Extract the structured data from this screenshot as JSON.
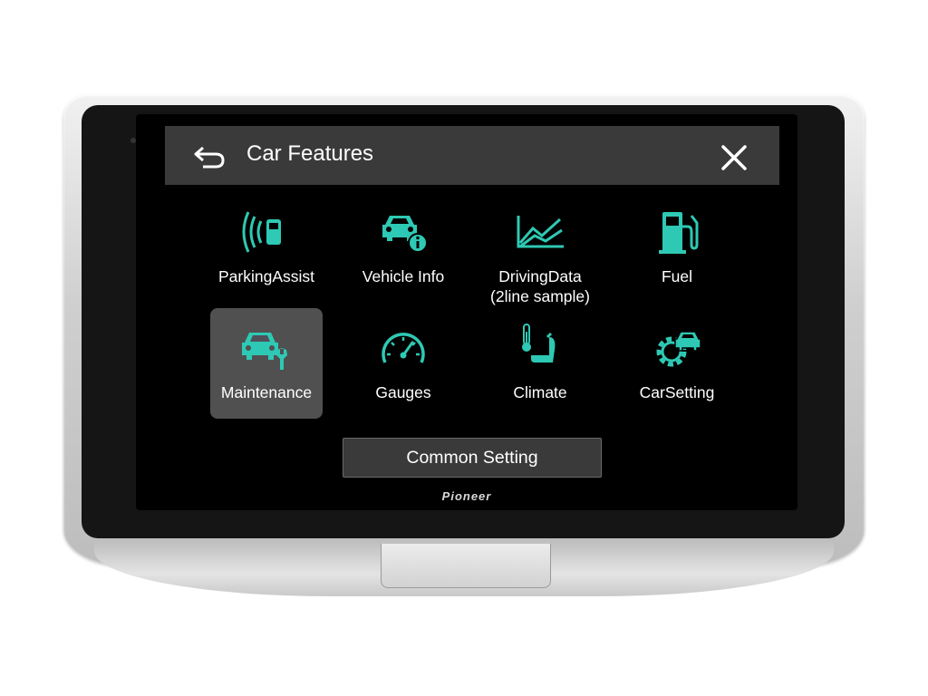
{
  "header": {
    "title": "Car Features",
    "back_icon": "back-arrow-icon",
    "close_icon": "close-icon"
  },
  "features": [
    {
      "label": "ParkingAssist",
      "icon": "parking-assist-icon",
      "selected": false
    },
    {
      "label": "Vehicle Info",
      "icon": "vehicle-info-icon",
      "selected": false
    },
    {
      "label": "DrivingData",
      "label_line2": "(2line sample)",
      "icon": "driving-data-icon",
      "selected": false
    },
    {
      "label": "Fuel",
      "icon": "fuel-pump-icon",
      "selected": false
    },
    {
      "label": "Maintenance",
      "icon": "maintenance-icon",
      "selected": true
    },
    {
      "label": "Gauges",
      "icon": "gauge-icon",
      "selected": false
    },
    {
      "label": "Climate",
      "icon": "climate-seat-icon",
      "selected": false
    },
    {
      "label": "CarSetting",
      "icon": "car-setting-icon",
      "selected": false
    }
  ],
  "common_setting": {
    "label": "Common Setting"
  },
  "brand": {
    "text": "Pioneer"
  },
  "side_buttons": [
    "source-icon",
    "microphone-icon",
    "phone-icon",
    "apps-grid-icon",
    "volume-up-icon",
    "volume-down-icon"
  ],
  "colors": {
    "accent": "#2ec9b4",
    "header_bg": "#3a3a3a",
    "selected_tile": "#505050"
  }
}
